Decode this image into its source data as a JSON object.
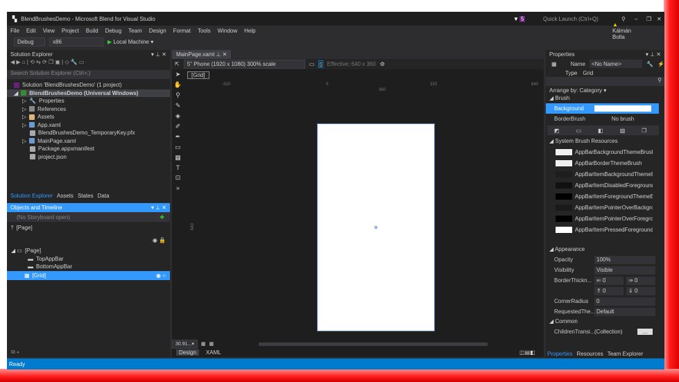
{
  "title": "BlendBrushesDemo - Microsoft Blend for Visual Studio",
  "notification_count": "5",
  "quick_launch": "Quick Launch (Ctrl+Q)",
  "user": "Kálmán Bolla",
  "menu": [
    "File",
    "Edit",
    "View",
    "Project",
    "Build",
    "Debug",
    "Team",
    "Design",
    "Format",
    "Tools",
    "Window",
    "Help"
  ],
  "toolbar": {
    "config": "Debug",
    "platform": "x86",
    "run": "Local Machine"
  },
  "solution_explorer": {
    "title": "Solution Explorer",
    "search_placeholder": "Search Solution Explorer (Ctrl+;)",
    "items": [
      "Solution 'BlendBrushesDemo' (1 project)",
      "BlendBrushesDemo (Universal Windows)",
      "Properties",
      "References",
      "Assets",
      "App.xaml",
      "BlendBrushesDemo_TemporaryKey.pfx",
      "MainPage.xaml",
      "Package.appxmanifest",
      "project.json"
    ],
    "tabs": [
      "Solution Explorer",
      "Assets",
      "States",
      "Data"
    ]
  },
  "objects": {
    "title": "Objects and Timeline",
    "storyboard": "(No Storyboard open)",
    "scope": "[Page]",
    "items": [
      "[Page]",
      "TopAppBar",
      "BottomAppBar",
      "[Grid]"
    ]
  },
  "editor": {
    "tab": "MainPage.xaml",
    "device": "5\" Phone (1920 x 1080) 300% scale",
    "effective": "Effective: 640 x 360",
    "breadcrumb": "[Grid]",
    "ruler": [
      "-320",
      "0",
      "320",
      "640"
    ],
    "ruler_width": "360",
    "ruler_height": "640",
    "zoom": "30.91...",
    "tabs": [
      "Design",
      "XAML"
    ]
  },
  "properties": {
    "title": "Properties",
    "name_label": "Name",
    "name_value": "<No Name>",
    "type_label": "Type",
    "type_value": "Grid",
    "arrange": "Arrange by: Category",
    "brush": {
      "section": "Brush",
      "background": "Background",
      "borderbrush": "BorderBrush",
      "no_brush": "No brush",
      "resources": "System Brush Resources",
      "list": [
        {
          "name": "AppBarBackgroundThemeBrush",
          "color": "#f0f0f0"
        },
        {
          "name": "AppBarBorderThemeBrush",
          "color": "#f0f0f0"
        },
        {
          "name": "AppBarItemBackgroundThemeBrush",
          "color": "#1e1e1e"
        },
        {
          "name": "AppBarItemDisabledForegroundThemeBrush",
          "color": "#111111"
        },
        {
          "name": "AppBarItemForegroundThemeBrush",
          "color": "#000000"
        },
        {
          "name": "AppBarItemPointerOverBackgroundThemeBrush",
          "color": "#1a1a1a"
        },
        {
          "name": "AppBarItemPointerOverForegroundThemeBrush",
          "color": "#000000"
        },
        {
          "name": "AppBarItemPressedForegroundThemeBrush",
          "color": "#ffffff"
        }
      ]
    },
    "appearance": {
      "section": "Appearance",
      "opacity_label": "Opacity",
      "opacity": "100%",
      "visibility_label": "Visibility",
      "visibility": "Visible",
      "border_label": "BorderThickn...",
      "border": [
        "0",
        "0",
        "0",
        "0"
      ],
      "corner_label": "CornerRadius",
      "corner": "0",
      "theme_label": "RequestedThe...",
      "theme": "Default"
    },
    "common": {
      "section": "Common",
      "children_label": "ChildrenTransi...",
      "children": "(Collection)",
      "button": "..."
    },
    "tabs": [
      "Properties",
      "Resources",
      "Team Explorer"
    ]
  },
  "status": "Ready",
  "colors": {
    "accent": "#007acc",
    "selection": "#3399ff",
    "background": "#2d2d30"
  }
}
